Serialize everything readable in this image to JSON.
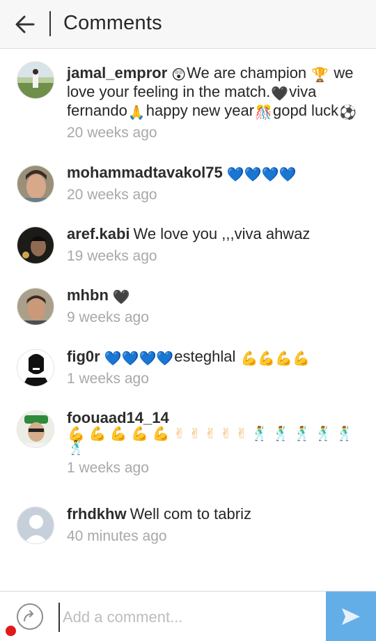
{
  "header": {
    "title": "Comments",
    "back_icon": "arrow-left-icon"
  },
  "comments": [
    {
      "username": "jamal_empror",
      "parts": [
        {
          "emoji": "😲"
        },
        {
          "text": "We are champion "
        },
        {
          "emoji": "🏆"
        },
        {
          "text": " we love your feeling in the match."
        },
        {
          "emoji": "🖤"
        },
        {
          "text": "viva fernando"
        },
        {
          "emoji": "🙏"
        },
        {
          "text": "happy new year"
        },
        {
          "emoji": "🎊"
        },
        {
          "text": "gopd luck"
        },
        {
          "emoji": "⚽"
        }
      ],
      "time": "20 weeks ago"
    },
    {
      "username": "mohammadtavakol75",
      "parts": [
        {
          "emoji": "💙💙💙💙"
        }
      ],
      "time": "20 weeks ago"
    },
    {
      "username": "aref.kabi",
      "parts": [
        {
          "text": "We love you ,,,viva ahwaz"
        }
      ],
      "time": "19 weeks ago"
    },
    {
      "username": "mhbn",
      "parts": [
        {
          "emoji": "🖤"
        }
      ],
      "time": "9 weeks ago"
    },
    {
      "username": "fig0r",
      "parts": [
        {
          "emoji": "💙💙💙💙"
        },
        {
          "text": "esteghlal "
        },
        {
          "emoji": "💪💪💪💪"
        }
      ],
      "time": "1 weeks ago"
    },
    {
      "username": "foouaad14_14",
      "parts": [
        {
          "emoji": "💪 💪 💪 💪 💪 ✌ ✌ ✌ ✌ ✌ 🕺 🕺 🕺 🕺 🕺 🕺"
        }
      ],
      "time": "1 weeks ago"
    },
    {
      "username": "frhdkhw",
      "parts": [
        {
          "text": "Well com to tabriz"
        }
      ],
      "time": "40 minutes ago"
    }
  ],
  "footer": {
    "reply_icon": "reply-arrow-icon",
    "placeholder": "Add a comment...",
    "send_icon": "send-arrow-icon"
  },
  "colors": {
    "send_button": "#64aee8",
    "timestamp": "#a8a8a8",
    "record_dot": "#e0191a"
  }
}
